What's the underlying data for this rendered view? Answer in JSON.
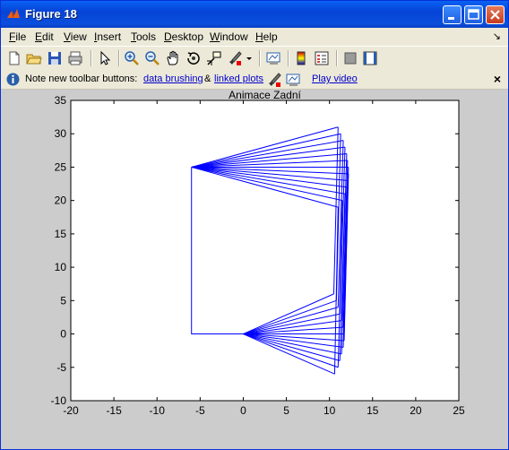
{
  "window": {
    "title": "Figure 18"
  },
  "menu": {
    "items": [
      {
        "key": "F",
        "rest": "ile"
      },
      {
        "key": "E",
        "rest": "dit"
      },
      {
        "key": "V",
        "rest": "iew"
      },
      {
        "key": "I",
        "rest": "nsert"
      },
      {
        "key": "T",
        "rest": "ools"
      },
      {
        "key": "D",
        "rest": "esktop"
      },
      {
        "key": "W",
        "rest": "indow"
      },
      {
        "key": "H",
        "rest": "elp"
      }
    ],
    "dock_arrow": "↘"
  },
  "toolbar": {
    "icons": [
      "new-figure-icon",
      "open-file-icon",
      "save-icon",
      "print-icon",
      "edit-plot-arrow-icon",
      "zoom-in-icon",
      "zoom-out-icon",
      "pan-hand-icon",
      "rotate-3d-icon",
      "data-cursor-icon",
      "brush-icon",
      "brush-dropdown-icon",
      "link-plot-icon",
      "colorbar-icon",
      "legend-icon",
      "hide-plot-tools-icon",
      "show-plot-tools-icon"
    ]
  },
  "infobar": {
    "text": "Note new toolbar buttons:",
    "link_brushing": "data brushing",
    "amp": "&",
    "link_linked": "linked plots",
    "link_video": "Play video",
    "close": "×"
  },
  "chart_data": {
    "type": "line",
    "title": "Animace Zadní",
    "xlim": [
      -20,
      25
    ],
    "ylim": [
      -10,
      35
    ],
    "xticks": [
      -20,
      -15,
      -10,
      -5,
      0,
      5,
      10,
      15,
      20,
      25
    ],
    "yticks": [
      -10,
      -5,
      0,
      5,
      10,
      15,
      20,
      25,
      30,
      35
    ],
    "color": "#0000ff",
    "hip": [
      -6,
      25
    ],
    "base": [
      [
        -6,
        25
      ],
      [
        -6,
        0
      ],
      [
        0,
        0
      ]
    ],
    "upper_tips": [
      [
        11,
        31
      ],
      [
        11.3,
        30
      ],
      [
        11.6,
        29
      ],
      [
        11.8,
        28
      ],
      [
        12,
        27
      ],
      [
        12.1,
        26
      ],
      [
        12.2,
        25
      ],
      [
        12.2,
        24
      ],
      [
        12.1,
        23
      ],
      [
        12,
        22
      ],
      [
        11.8,
        21
      ],
      [
        11.5,
        20
      ],
      [
        11,
        19
      ]
    ],
    "lower_tips": [
      [
        10.5,
        6
      ],
      [
        10.8,
        5
      ],
      [
        11,
        4
      ],
      [
        11.2,
        3
      ],
      [
        11.4,
        2
      ],
      [
        11.6,
        1
      ],
      [
        11.7,
        0
      ],
      [
        11.7,
        -1
      ],
      [
        11.6,
        -2
      ],
      [
        11.4,
        -3
      ],
      [
        11.2,
        -4
      ],
      [
        11,
        -5
      ],
      [
        10.6,
        -6
      ]
    ]
  }
}
